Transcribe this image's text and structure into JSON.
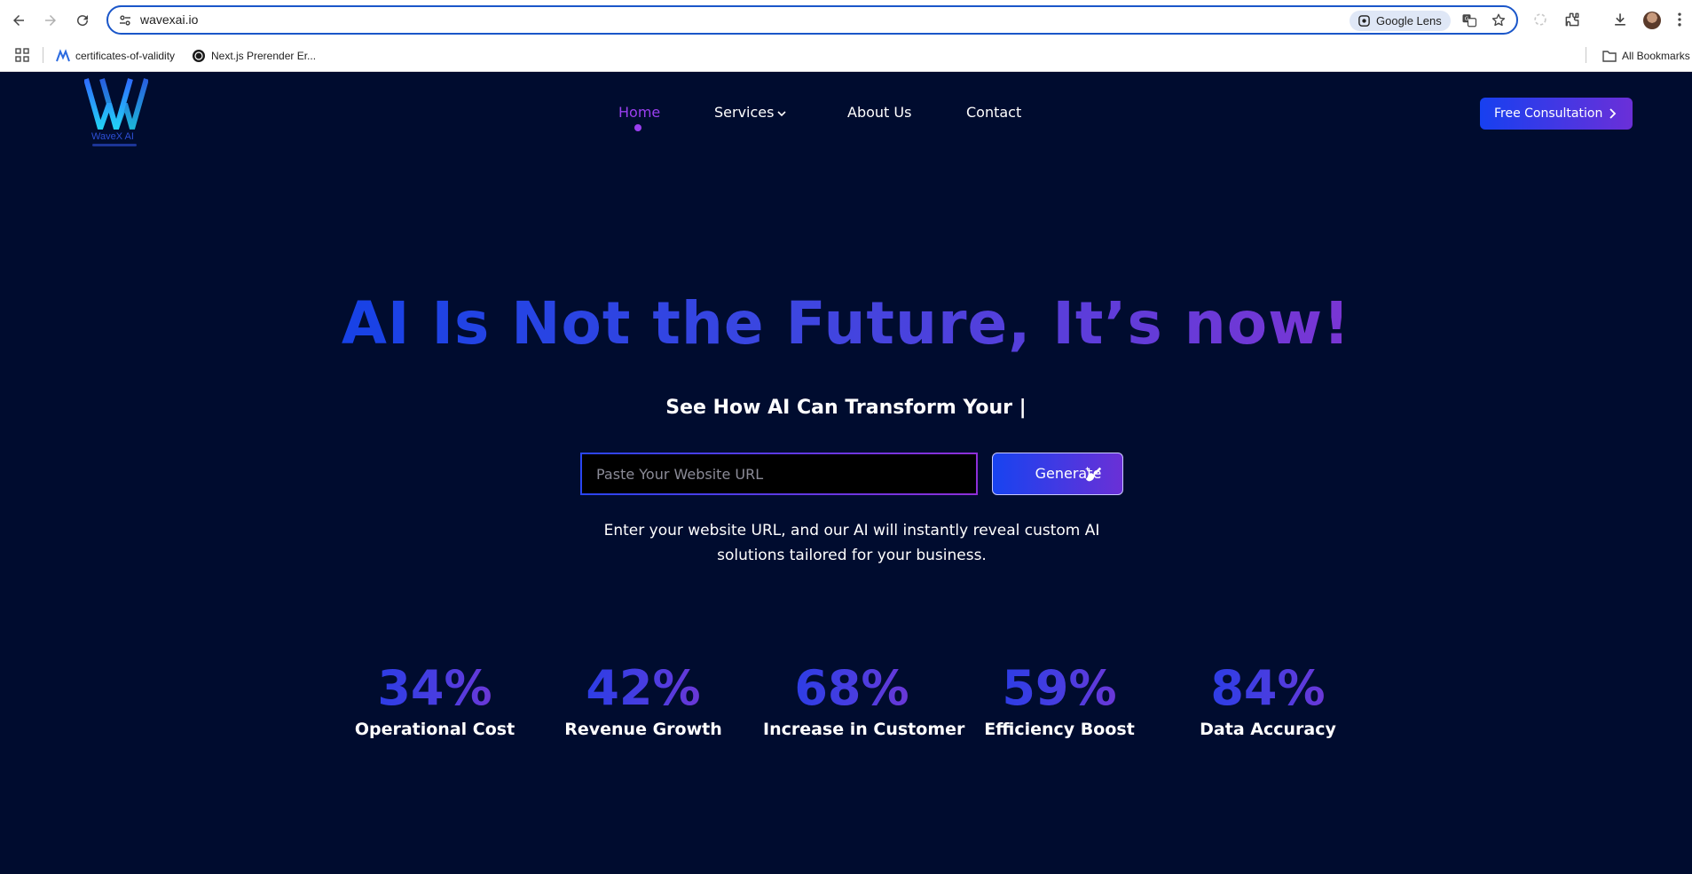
{
  "browser": {
    "url": "wavexai.io",
    "lens_label": "Google Lens",
    "bookmarks": [
      {
        "label": "certificates-of-validity",
        "icon": "blue-logo-icon"
      },
      {
        "label": "Next.js Prerender Er...",
        "icon": "circle-logo-icon"
      }
    ],
    "all_bookmarks_label": "All Bookmarks"
  },
  "site": {
    "logo_text": "WaveX AI",
    "nav": {
      "items": [
        {
          "label": "Home",
          "active": true
        },
        {
          "label": "Services",
          "has_dropdown": true
        },
        {
          "label": "About Us"
        },
        {
          "label": "Contact"
        }
      ]
    },
    "cta_label": "Free Consultation"
  },
  "hero": {
    "title": "AI Is Not the Future, It’s now!",
    "subtitle": "See How AI Can Transform Your |",
    "input_placeholder": "Paste Your Website URL",
    "generate_label": "Generate",
    "description": "Enter your website URL, and our AI will instantly reveal custom AI solutions tailored for your business."
  },
  "stats": [
    {
      "value": "34%",
      "label": "Operational Cost"
    },
    {
      "value": "42%",
      "label": "Revenue Growth"
    },
    {
      "value": "68%",
      "label": "Increase in Customer"
    },
    {
      "value": "59%",
      "label": "Efficiency Boost"
    },
    {
      "value": "84%",
      "label": "Data Accuracy"
    }
  ],
  "colors": {
    "page_bg": "#000c2f",
    "accent_blue": "#1740f0",
    "accent_purple": "#7a35d4",
    "active_nav": "#9a3ff0",
    "browser_focus": "#1a56c9"
  }
}
